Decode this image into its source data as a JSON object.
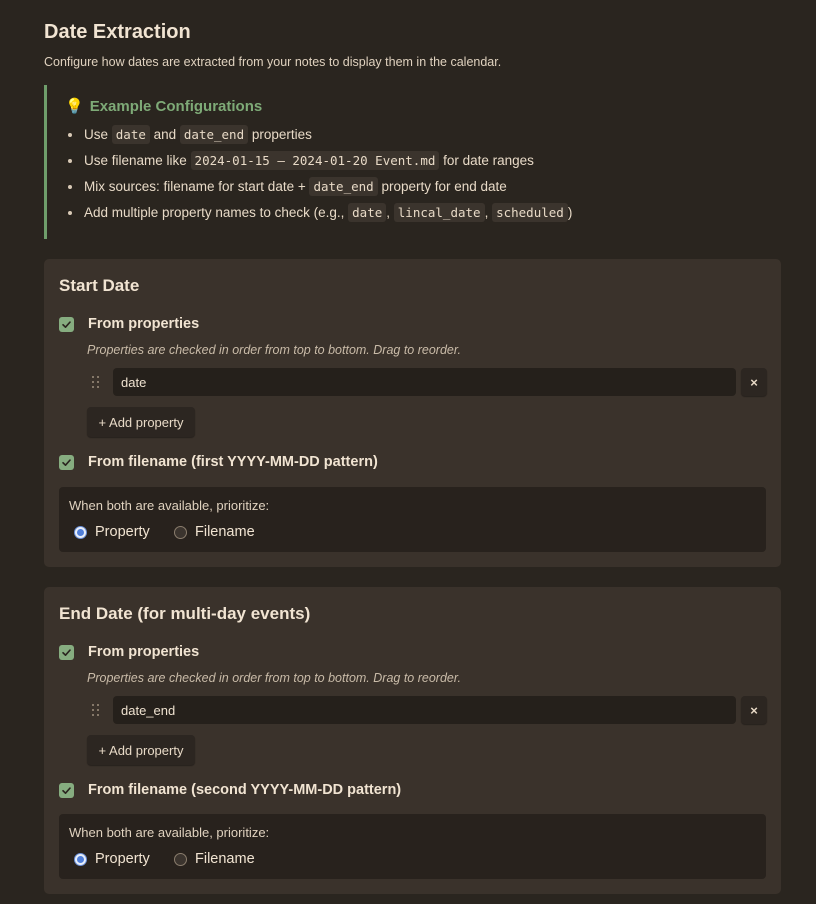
{
  "header": {
    "title": "Date Extraction",
    "description": "Configure how dates are extracted from your notes to display them in the calendar."
  },
  "callout": {
    "icon": "lightbulb-icon",
    "title": "Example Configurations",
    "items": [
      {
        "parts": [
          {
            "t": "Use "
          },
          {
            "c": "date"
          },
          {
            "t": " and "
          },
          {
            "c": "date_end"
          },
          {
            "t": " properties"
          }
        ]
      },
      {
        "parts": [
          {
            "t": "Use filename like "
          },
          {
            "c": "2024-01-15 – 2024-01-20 Event.md"
          },
          {
            "t": " for date ranges"
          }
        ]
      },
      {
        "parts": [
          {
            "t": "Mix sources: filename for start date + "
          },
          {
            "c": "date_end"
          },
          {
            "t": " property for end date"
          }
        ]
      },
      {
        "parts": [
          {
            "t": "Add multiple property names to check (e.g., "
          },
          {
            "c": "date"
          },
          {
            "t": ", "
          },
          {
            "c": "lincal_date"
          },
          {
            "t": ", "
          },
          {
            "c": "scheduled"
          },
          {
            "t": ")"
          }
        ]
      }
    ]
  },
  "start_date": {
    "title": "Start Date",
    "from_properties_label": "From properties",
    "from_properties_checked": true,
    "hint": "Properties are checked in order from top to bottom. Drag to reorder.",
    "property_value": "date",
    "remove_label": "×",
    "add_property_label": "+ Add property",
    "from_filename_label": "From filename (first YYYY-MM-DD pattern)",
    "from_filename_checked": true,
    "prioritize_label": "When both are available, prioritize:",
    "option_property": "Property",
    "option_filename": "Filename",
    "selected": "Property"
  },
  "end_date": {
    "title": "End Date (for multi-day events)",
    "from_properties_label": "From properties",
    "from_properties_checked": true,
    "hint": "Properties are checked in order from top to bottom. Drag to reorder.",
    "property_value": "date_end",
    "remove_label": "×",
    "add_property_label": "+ Add property",
    "from_filename_label": "From filename (second YYYY-MM-DD pattern)",
    "from_filename_checked": true,
    "prioritize_label": "When both are available, prioritize:",
    "option_property": "Property",
    "option_filename": "Filename",
    "selected": "Property"
  },
  "colors": {
    "background": "#2a251f",
    "card": "#3a322b",
    "accent_green": "#7eaa77",
    "checkbox": "#86ad80",
    "radio_selected": "#4f7ed9"
  }
}
